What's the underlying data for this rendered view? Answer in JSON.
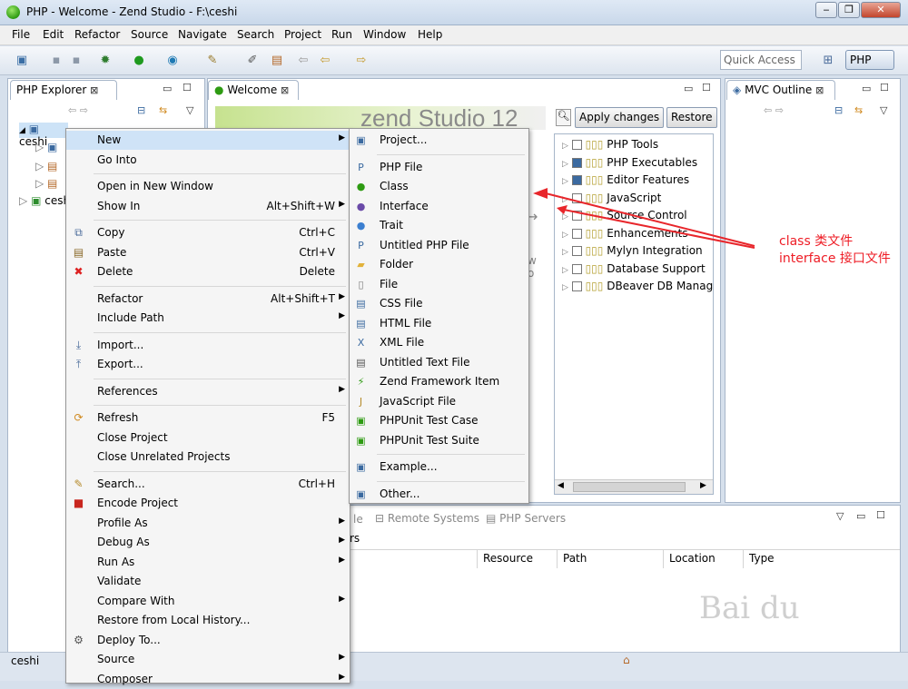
{
  "window": {
    "title": "PHP - Welcome - Zend Studio - F:\\ceshi",
    "min": "‒",
    "max": "❐",
    "close": "✕"
  },
  "menubar": [
    "File",
    "Edit",
    "Refactor",
    "Source",
    "Navigate",
    "Search",
    "Project",
    "Run",
    "Window",
    "Help"
  ],
  "toolbar": {
    "quick_access": "Quick Access",
    "perspective": "PHP"
  },
  "explorer": {
    "tab": "PHP Explorer",
    "items": [
      "ceshi",
      "ceshi"
    ]
  },
  "welcome": {
    "tab": "Welcome",
    "logo": "zend Studio 12",
    "apply": "Apply changes",
    "restore": "Restore",
    "features": [
      "PHP Tools",
      "PHP Executables",
      "Editor Features",
      "JavaScript",
      "Source Control",
      "Enhancements",
      "Mylyn Integration",
      "Database Support",
      "DBeaver DB Manag"
    ]
  },
  "mvc": {
    "tab": "MVC Outline"
  },
  "bottom": {
    "tabs": [
      "Remote Systems",
      "PHP Servers"
    ],
    "columns": [
      "Resource",
      "Path",
      "Location",
      "Type"
    ],
    "frag1": "le",
    "frag2": "rs"
  },
  "context_menu": [
    {
      "label": "New",
      "arrow": true
    },
    {
      "label": "Go Into"
    },
    {
      "sep": true
    },
    {
      "label": "Open in New Window"
    },
    {
      "label": "Show In",
      "shortcut": "Alt+Shift+W",
      "arrow": true
    },
    {
      "sep": true
    },
    {
      "label": "Copy",
      "shortcut": "Ctrl+C",
      "icon": "copy-icon"
    },
    {
      "label": "Paste",
      "shortcut": "Ctrl+V",
      "icon": "paste-icon"
    },
    {
      "label": "Delete",
      "shortcut": "Delete",
      "icon": "delete-icon"
    },
    {
      "sep": true
    },
    {
      "label": "Refactor",
      "shortcut": "Alt+Shift+T",
      "arrow": true
    },
    {
      "label": "Include Path",
      "arrow": true
    },
    {
      "sep": true
    },
    {
      "label": "Import...",
      "icon": "import-icon"
    },
    {
      "label": "Export...",
      "icon": "export-icon"
    },
    {
      "sep": true
    },
    {
      "label": "References",
      "arrow": true
    },
    {
      "sep": true
    },
    {
      "label": "Refresh",
      "shortcut": "F5",
      "icon": "refresh-icon"
    },
    {
      "label": "Close Project"
    },
    {
      "label": "Close Unrelated Projects"
    },
    {
      "sep": true
    },
    {
      "label": "Search...",
      "shortcut": "Ctrl+H",
      "icon": "search-icon"
    },
    {
      "label": "Encode Project",
      "icon": "encode-icon"
    },
    {
      "label": "Profile As",
      "arrow": true
    },
    {
      "label": "Debug As",
      "arrow": true
    },
    {
      "label": "Run As",
      "arrow": true
    },
    {
      "label": "Validate"
    },
    {
      "label": "Compare With",
      "arrow": true
    },
    {
      "label": "Restore from Local History..."
    },
    {
      "label": "Deploy To...",
      "icon": "deploy-icon"
    },
    {
      "label": "Source",
      "arrow": true
    },
    {
      "label": "Composer",
      "arrow": true
    }
  ],
  "submenu": [
    {
      "label": "Project...",
      "icon": "project-icon"
    },
    {
      "sep": true
    },
    {
      "label": "PHP File",
      "icon": "php-file-icon"
    },
    {
      "label": "Class",
      "icon": "class-icon"
    },
    {
      "label": "Interface",
      "icon": "interface-icon"
    },
    {
      "label": "Trait",
      "icon": "trait-icon"
    },
    {
      "label": "Untitled PHP File",
      "icon": "php-file-icon"
    },
    {
      "label": "Folder",
      "icon": "folder-icon"
    },
    {
      "label": "File",
      "icon": "file-icon"
    },
    {
      "label": "CSS File",
      "icon": "css-file-icon"
    },
    {
      "label": "HTML File",
      "icon": "html-file-icon"
    },
    {
      "label": "XML File",
      "icon": "xml-file-icon"
    },
    {
      "label": "Untitled Text File",
      "icon": "text-file-icon"
    },
    {
      "label": "Zend Framework Item",
      "icon": "zend-icon"
    },
    {
      "label": "JavaScript File",
      "icon": "js-file-icon"
    },
    {
      "label": "PHPUnit Test Case",
      "icon": "phpunit-icon"
    },
    {
      "label": "PHPUnit Test Suite",
      "icon": "phpunit-icon"
    },
    {
      "sep": true
    },
    {
      "label": "Example...",
      "icon": "example-icon"
    },
    {
      "sep": true
    },
    {
      "label": "Other...",
      "icon": "other-icon"
    }
  ],
  "annotation": {
    "line1": "class 类文件",
    "line2": "interface 接口文件"
  },
  "status": {
    "text": "ceshi"
  },
  "colors": {
    "accent": "#e8262b",
    "panel_border": "#a7b6c9"
  }
}
